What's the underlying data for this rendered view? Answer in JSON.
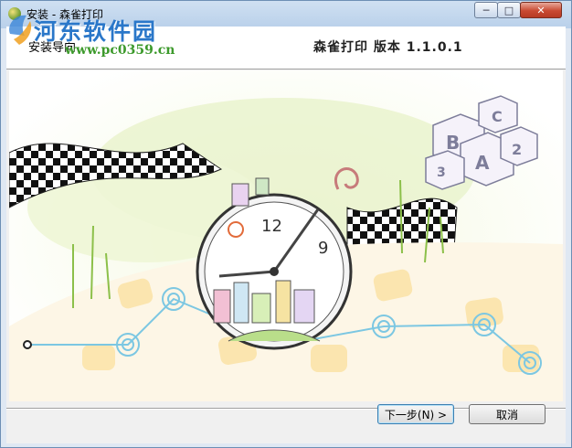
{
  "window": {
    "title": "安装 - 森雀打印"
  },
  "header": {
    "left_text": "安装导向",
    "product_version": "森雀打印 版本 1.1.0.1"
  },
  "watermark": {
    "site_name": "河东软件园",
    "url": "www.pc0359.cn"
  },
  "banner": {
    "block_letters": [
      "B",
      "A",
      "C",
      "2",
      "3"
    ],
    "clock_numbers": [
      "12",
      "9"
    ]
  },
  "buttons": {
    "next": "下一步(N) >",
    "cancel": "取消"
  },
  "colors": {
    "accent": "#3c7fb1",
    "watermark_blue": "#2a77c9",
    "watermark_green": "#3d9a2c",
    "close_red": "#c94a32"
  },
  "icons": {
    "app": "app-icon",
    "minimize": "minimize-icon",
    "maximize": "maximize-icon",
    "close": "close-icon"
  }
}
